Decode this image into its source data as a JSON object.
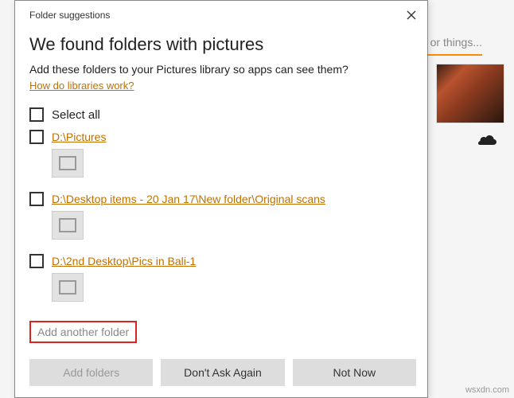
{
  "dialog": {
    "title": "Folder suggestions",
    "headline": "We found folders with pictures",
    "subtext": "Add these folders to your Pictures library so apps can see them?",
    "help_link": "How do libraries work?",
    "select_all_label": "Select all",
    "folders": [
      {
        "path": "D:\\Pictures"
      },
      {
        "path": "D:\\Desktop items - 20 Jan 17\\New folder\\Original scans"
      },
      {
        "path": "D:\\2nd Desktop\\Pics in Bali-1"
      }
    ],
    "add_another_label": "Add another folder",
    "buttons": {
      "add": "Add folders",
      "dont_ask": "Don't Ask Again",
      "not_now": "Not Now"
    }
  },
  "background": {
    "search_hint": "s, or things...",
    "watermark": "wsxdn.com"
  }
}
